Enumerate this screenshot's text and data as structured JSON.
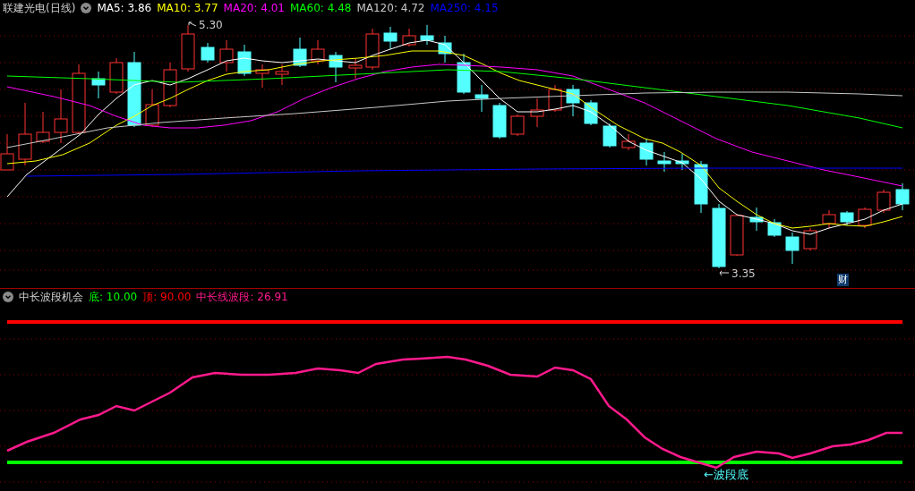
{
  "price_panel": {
    "title": "联建光电(日线)",
    "moving_averages": [
      {
        "label": "MA5: 3.86",
        "color": "#ffffff"
      },
      {
        "label": "MA10: 3.77",
        "color": "#ffff00"
      },
      {
        "label": "MA20: 4.01",
        "color": "#ff00ff"
      },
      {
        "label": "MA60: 4.48",
        "color": "#00ff00"
      },
      {
        "label": "MA120: 4.72",
        "color": "#c8c8c8"
      },
      {
        "label": "MA250: 4.15",
        "color": "#0000ff"
      }
    ],
    "high_label": "5.30",
    "low_label": "3.35",
    "badge": "财"
  },
  "indicator_panel": {
    "title": "中长波段机会",
    "values": [
      {
        "label": "底: 10.00",
        "color": "#00ff00"
      },
      {
        "label": "顶: 90.00",
        "color": "#ff0000"
      },
      {
        "label": "中长线波段: 26.91",
        "color": "#ff1a8c"
      }
    ],
    "annotation": "←波段底"
  }
}
